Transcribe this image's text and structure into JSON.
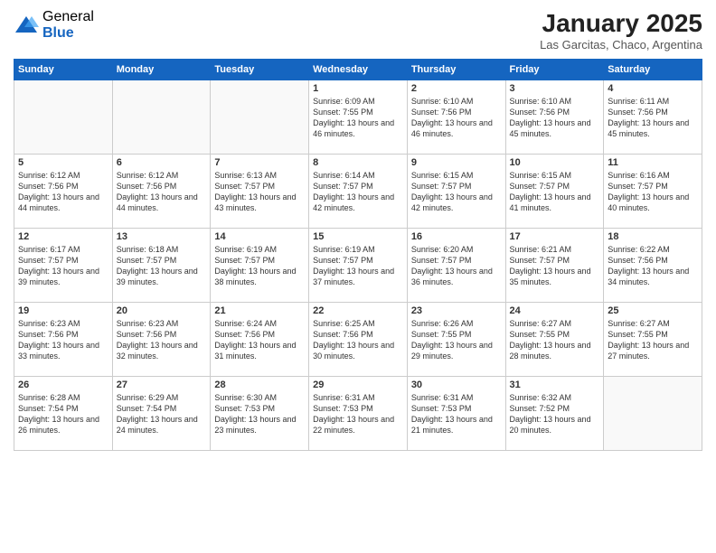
{
  "header": {
    "logo_general": "General",
    "logo_blue": "Blue",
    "month_title": "January 2025",
    "location": "Las Garcitas, Chaco, Argentina"
  },
  "weekdays": [
    "Sunday",
    "Monday",
    "Tuesday",
    "Wednesday",
    "Thursday",
    "Friday",
    "Saturday"
  ],
  "weeks": [
    [
      {
        "day": "",
        "empty": true
      },
      {
        "day": "",
        "empty": true
      },
      {
        "day": "",
        "empty": true
      },
      {
        "day": "1",
        "sunrise": "6:09 AM",
        "sunset": "7:55 PM",
        "daylight": "13 hours and 46 minutes."
      },
      {
        "day": "2",
        "sunrise": "6:10 AM",
        "sunset": "7:56 PM",
        "daylight": "13 hours and 46 minutes."
      },
      {
        "day": "3",
        "sunrise": "6:10 AM",
        "sunset": "7:56 PM",
        "daylight": "13 hours and 45 minutes."
      },
      {
        "day": "4",
        "sunrise": "6:11 AM",
        "sunset": "7:56 PM",
        "daylight": "13 hours and 45 minutes."
      }
    ],
    [
      {
        "day": "5",
        "sunrise": "6:12 AM",
        "sunset": "7:56 PM",
        "daylight": "13 hours and 44 minutes."
      },
      {
        "day": "6",
        "sunrise": "6:12 AM",
        "sunset": "7:56 PM",
        "daylight": "13 hours and 44 minutes."
      },
      {
        "day": "7",
        "sunrise": "6:13 AM",
        "sunset": "7:57 PM",
        "daylight": "13 hours and 43 minutes."
      },
      {
        "day": "8",
        "sunrise": "6:14 AM",
        "sunset": "7:57 PM",
        "daylight": "13 hours and 42 minutes."
      },
      {
        "day": "9",
        "sunrise": "6:15 AM",
        "sunset": "7:57 PM",
        "daylight": "13 hours and 42 minutes."
      },
      {
        "day": "10",
        "sunrise": "6:15 AM",
        "sunset": "7:57 PM",
        "daylight": "13 hours and 41 minutes."
      },
      {
        "day": "11",
        "sunrise": "6:16 AM",
        "sunset": "7:57 PM",
        "daylight": "13 hours and 40 minutes."
      }
    ],
    [
      {
        "day": "12",
        "sunrise": "6:17 AM",
        "sunset": "7:57 PM",
        "daylight": "13 hours and 39 minutes."
      },
      {
        "day": "13",
        "sunrise": "6:18 AM",
        "sunset": "7:57 PM",
        "daylight": "13 hours and 39 minutes."
      },
      {
        "day": "14",
        "sunrise": "6:19 AM",
        "sunset": "7:57 PM",
        "daylight": "13 hours and 38 minutes."
      },
      {
        "day": "15",
        "sunrise": "6:19 AM",
        "sunset": "7:57 PM",
        "daylight": "13 hours and 37 minutes."
      },
      {
        "day": "16",
        "sunrise": "6:20 AM",
        "sunset": "7:57 PM",
        "daylight": "13 hours and 36 minutes."
      },
      {
        "day": "17",
        "sunrise": "6:21 AM",
        "sunset": "7:57 PM",
        "daylight": "13 hours and 35 minutes."
      },
      {
        "day": "18",
        "sunrise": "6:22 AM",
        "sunset": "7:56 PM",
        "daylight": "13 hours and 34 minutes."
      }
    ],
    [
      {
        "day": "19",
        "sunrise": "6:23 AM",
        "sunset": "7:56 PM",
        "daylight": "13 hours and 33 minutes."
      },
      {
        "day": "20",
        "sunrise": "6:23 AM",
        "sunset": "7:56 PM",
        "daylight": "13 hours and 32 minutes."
      },
      {
        "day": "21",
        "sunrise": "6:24 AM",
        "sunset": "7:56 PM",
        "daylight": "13 hours and 31 minutes."
      },
      {
        "day": "22",
        "sunrise": "6:25 AM",
        "sunset": "7:56 PM",
        "daylight": "13 hours and 30 minutes."
      },
      {
        "day": "23",
        "sunrise": "6:26 AM",
        "sunset": "7:55 PM",
        "daylight": "13 hours and 29 minutes."
      },
      {
        "day": "24",
        "sunrise": "6:27 AM",
        "sunset": "7:55 PM",
        "daylight": "13 hours and 28 minutes."
      },
      {
        "day": "25",
        "sunrise": "6:27 AM",
        "sunset": "7:55 PM",
        "daylight": "13 hours and 27 minutes."
      }
    ],
    [
      {
        "day": "26",
        "sunrise": "6:28 AM",
        "sunset": "7:54 PM",
        "daylight": "13 hours and 26 minutes."
      },
      {
        "day": "27",
        "sunrise": "6:29 AM",
        "sunset": "7:54 PM",
        "daylight": "13 hours and 24 minutes."
      },
      {
        "day": "28",
        "sunrise": "6:30 AM",
        "sunset": "7:53 PM",
        "daylight": "13 hours and 23 minutes."
      },
      {
        "day": "29",
        "sunrise": "6:31 AM",
        "sunset": "7:53 PM",
        "daylight": "13 hours and 22 minutes."
      },
      {
        "day": "30",
        "sunrise": "6:31 AM",
        "sunset": "7:53 PM",
        "daylight": "13 hours and 21 minutes."
      },
      {
        "day": "31",
        "sunrise": "6:32 AM",
        "sunset": "7:52 PM",
        "daylight": "13 hours and 20 minutes."
      },
      {
        "day": "",
        "empty": true
      }
    ]
  ],
  "labels": {
    "sunrise": "Sunrise:",
    "sunset": "Sunset:",
    "daylight": "Daylight hours"
  }
}
